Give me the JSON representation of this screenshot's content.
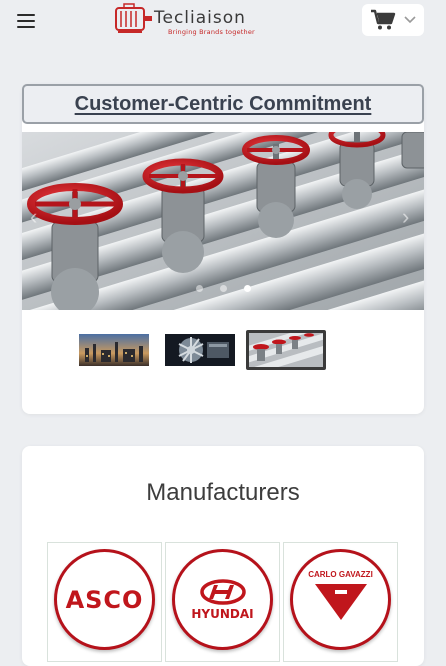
{
  "header": {
    "brand_name": "Tecliaison",
    "brand_tagline": "Bringing Brands together",
    "menu_icon": "hamburger-menu-icon",
    "cart_icon": "shopping-cart-icon",
    "cart_dropdown_icon": "chevron-down-icon"
  },
  "commitment": {
    "title": "Customer-Centric Commitment",
    "carousel": {
      "active_slide": 3,
      "slide_count": 3,
      "thumbnails": [
        "industrial-plant-thumbnail",
        "turbine-thumbnail",
        "valves-thumbnail"
      ]
    }
  },
  "manufacturers": {
    "title": "Manufacturers",
    "logos": [
      {
        "name": "ASCO",
        "text": "ASCO"
      },
      {
        "name": "HYUNDAI",
        "text": "HYUNDAI"
      },
      {
        "name": "CARLO GAVAZZI",
        "text": "CARLO GAVAZZI"
      }
    ]
  },
  "colors": {
    "brand_red": "#c62828",
    "valve_red": "#c0161c",
    "background": "#eceef1"
  }
}
